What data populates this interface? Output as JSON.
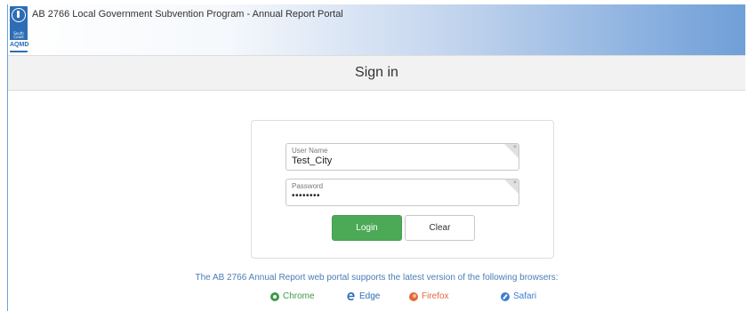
{
  "header": {
    "title": "AB 2766 Local Government Subvention Program - Annual Report Portal",
    "logo_text": "AQMD",
    "logo_sub": "South Coast"
  },
  "signin": {
    "heading": "Sign in"
  },
  "form": {
    "username_label": "User Name",
    "username_value": "Test_City",
    "password_label": "Password",
    "password_value": "••••••••",
    "required_marker": "*",
    "login_label": "Login",
    "clear_label": "Clear"
  },
  "support": {
    "text": "The AB 2766 Annual Report web portal supports the latest version of the following browsers:",
    "browsers": [
      {
        "name": "Chrome",
        "icon": "chrome-icon",
        "color": "#3d9a47"
      },
      {
        "name": "Edge",
        "icon": "edge-icon",
        "color": "#2b6fb6"
      },
      {
        "name": "Firefox",
        "icon": "firefox-icon",
        "color": "#e06a3b"
      },
      {
        "name": "Safari",
        "icon": "safari-icon",
        "color": "#3b7fd0"
      }
    ]
  },
  "colors": {
    "primary_blue": "#2d6db5",
    "login_green": "#4caa57",
    "link_blue": "#4a7db8"
  }
}
